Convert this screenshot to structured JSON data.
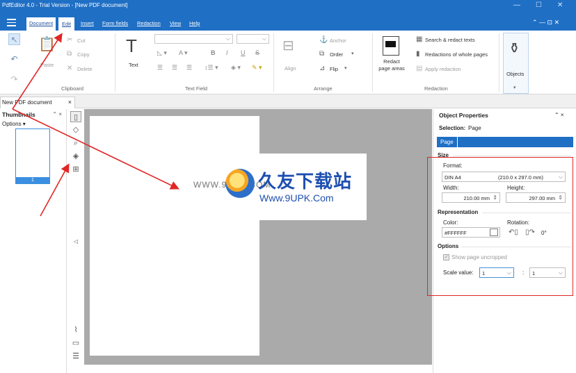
{
  "window": {
    "title": "PdfEditor 4.0 - Trial Version - [New PDF document]",
    "controls": [
      "—",
      "☐",
      "✕"
    ]
  },
  "menu": {
    "tabs": [
      "Document",
      "Edit",
      "Insert",
      "Form fields",
      "Redaction",
      "View",
      "Help"
    ],
    "active_tab": "Document",
    "right_controls": "⌃ — ⊡ ✕"
  },
  "ribbon": {
    "clipboard": {
      "group": "Clipboard",
      "paste": "Paste",
      "cut": "Cut",
      "copy": "Copy",
      "delete": "Delete"
    },
    "textfield": {
      "group": "Text Field",
      "text": "Text"
    },
    "arrange": {
      "group": "Arrange",
      "align": "Align",
      "anchor": "Anchor",
      "order": "Order",
      "flip": "Flip"
    },
    "redaction": {
      "group": "Redaction",
      "redact_areas": "Redact page areas",
      "search_redact": "Search & redact texts",
      "redact_whole": "Redactions of whole pages",
      "apply": "Apply redaction"
    },
    "objects": {
      "label": "Objects"
    }
  },
  "document_tab": {
    "label": "New PDF document",
    "close": "×"
  },
  "thumbnails": {
    "title": "Thumbnails",
    "options": "Options ▾",
    "controls": "⌃ ×",
    "page_number": "1"
  },
  "watermark": {
    "url_left": "WWW.9UPK.COM",
    "chinese": "久友下载站",
    "url": "Www.9UPK.Com"
  },
  "properties": {
    "title": "Object Properties",
    "controls": "⌃ ×",
    "selection_label": "Selection:",
    "selection_value": "Page",
    "tab": "Page",
    "size_section": "Size",
    "format_label": "Format:",
    "format_value": "DIN A4",
    "format_dims": "(210.0 x 297.0 mm)",
    "width_label": "Width:",
    "width_value": "210.00 mm",
    "height_label": "Height:",
    "height_value": "297.00 mm",
    "representation_section": "Representation",
    "color_label": "Color:",
    "color_value": "#FFFFFF",
    "rotation_label": "Rotation:",
    "rotation_value": "0°",
    "options_section": "Options",
    "show_uncropped": "Show page uncropped",
    "scale_label": "Scale value:",
    "scale_value_1": "1",
    "scale_separator": ":",
    "scale_value_2": "1"
  },
  "colors": {
    "accent": "#1f6fc5",
    "annotation": "#e12626",
    "canvas_bg": "#aaaaaa"
  }
}
